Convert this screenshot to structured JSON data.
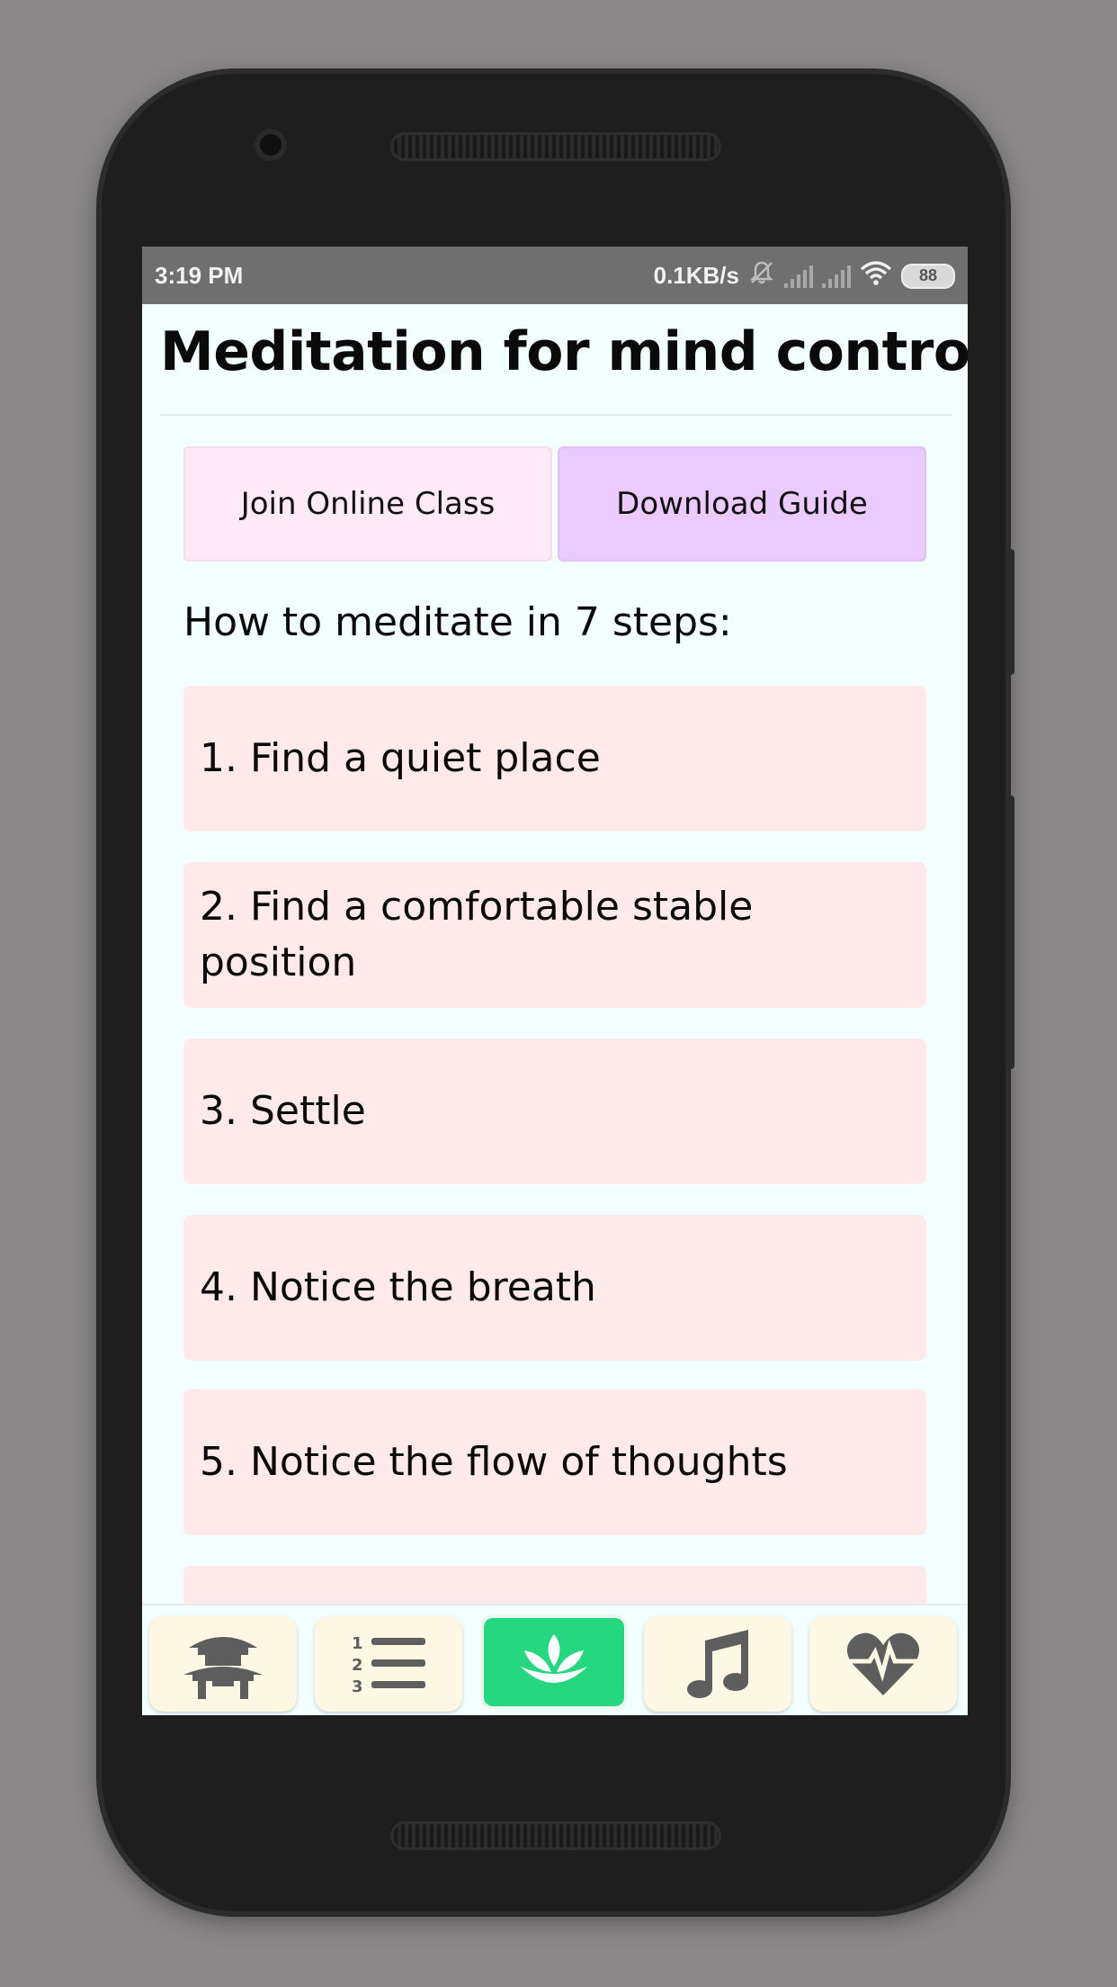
{
  "status": {
    "time": "3:19 PM",
    "network_speed": "0.1KB/s",
    "battery": "88"
  },
  "page": {
    "title": "Meditation for mind control",
    "subtitle": "How to meditate in 7 steps:"
  },
  "actions": {
    "join_label": "Join Online Class",
    "guide_label": "Download Guide"
  },
  "steps": [
    "1. Find a quiet place",
    "2. Find a comfortable stable position",
    "3. Settle",
    "4. Notice the breath",
    "5. Notice the flow of thoughts"
  ],
  "nav": [
    {
      "icon": "pagoda-icon",
      "active": false
    },
    {
      "icon": "numbered-list-icon",
      "active": false
    },
    {
      "icon": "lotus-icon",
      "active": true
    },
    {
      "icon": "music-note-icon",
      "active": false
    },
    {
      "icon": "heartbeat-icon",
      "active": false
    }
  ],
  "colors": {
    "nav_active": "#25d880",
    "nav_inactive": "#fcf8e4",
    "step_bg": "#ffe9eb",
    "join_bg": "#feeaf6",
    "guide_bg": "#ebcbff"
  }
}
